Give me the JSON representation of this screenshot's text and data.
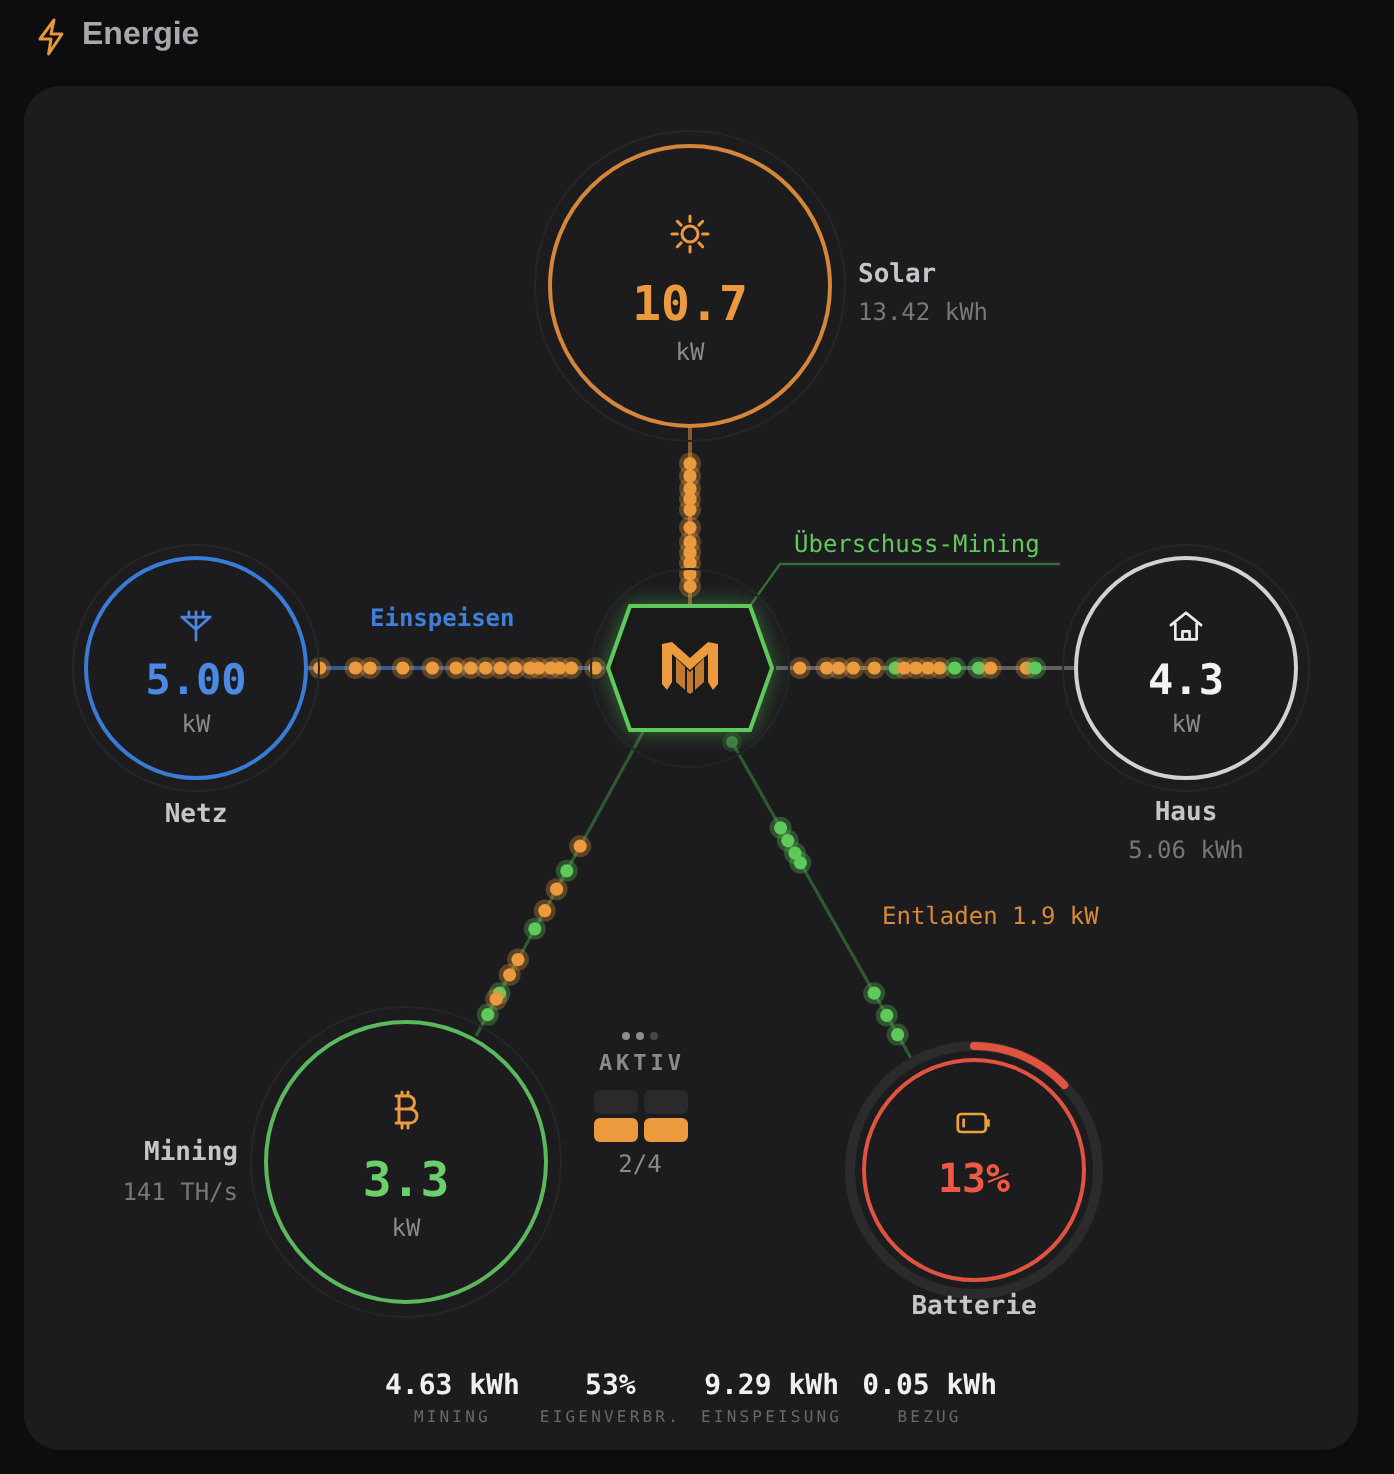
{
  "header": {
    "title": "Energie"
  },
  "solar": {
    "label": "Solar",
    "value": "10.7",
    "unit": "kW",
    "energy": "13.42 kWh"
  },
  "hub": {
    "label": "Überschuss-Mining"
  },
  "grid": {
    "label": "Netz",
    "value": "5.00",
    "unit": "kW",
    "flow_label": "Einspeisen"
  },
  "house": {
    "label": "Haus",
    "value": "4.3",
    "unit": "kW",
    "energy": "5.06 kWh"
  },
  "mining": {
    "label": "Mining",
    "value": "3.3",
    "unit": "kW",
    "hashrate": "141 TH/s"
  },
  "miners": {
    "dots": [
      {
        "on": true
      },
      {
        "on": true
      },
      {
        "on": false
      }
    ],
    "status": "AKTIV",
    "units": [
      {
        "on": false
      },
      {
        "on": false
      },
      {
        "on": true
      },
      {
        "on": true
      }
    ],
    "count": "2/4"
  },
  "battery": {
    "label": "Batterie",
    "value": "13%",
    "level": 0.13,
    "flow_label": "Entladen 1.9 kW"
  },
  "stats": [
    {
      "value": "4.63 kWh",
      "label": "MINING"
    },
    {
      "value": "53%",
      "label": "EIGENVERBR."
    },
    {
      "value": "9.29 kWh",
      "label": "EINSPEISUNG"
    },
    {
      "value": "0.05 kWh",
      "label": "BEZUG"
    }
  ]
}
